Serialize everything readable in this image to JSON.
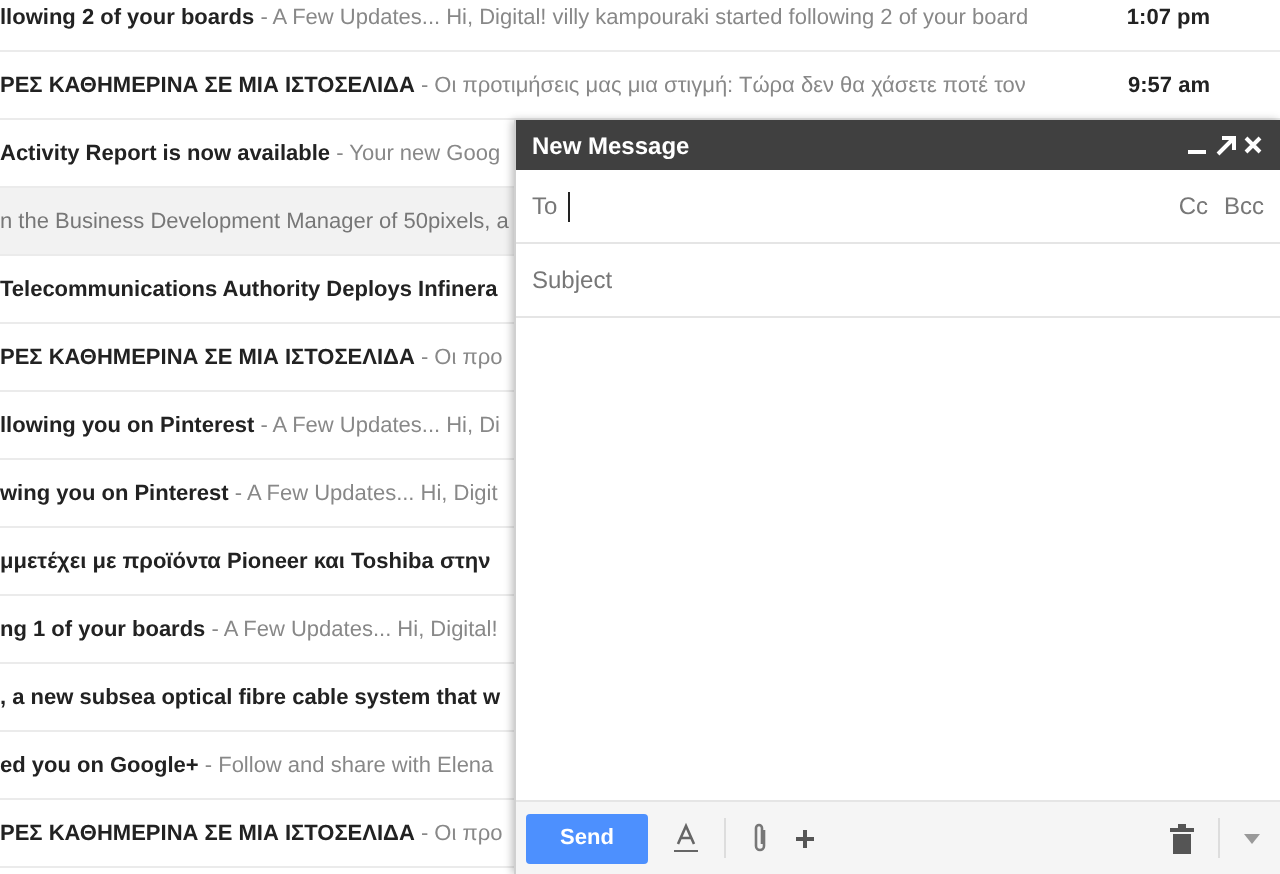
{
  "messages": [
    {
      "subject": "llowing 2 of your boards",
      "snippet": " - A Few Updates... Hi, Digital! villy kampouraki started following 2 of your board",
      "time": "1:07 pm",
      "read": false
    },
    {
      "subject": "ΡΕΣ ΚΑΘΗΜΕΡΙΝΑ ΣΕ ΜΙΑ ΙΣΤΟΣΕΛΙΔΑ",
      "snippet": " - Οι προτιμήσεις μας μια στιγμή: Τώρα δεν θα χάσετε ποτέ τον",
      "time": "9:57 am",
      "read": false
    },
    {
      "subject": "Activity Report is now available",
      "snippet": " - Your new Goog",
      "read": false
    },
    {
      "snippet": "n the Business Development Manager of 50pixels, a",
      "read": true
    },
    {
      "subject": "Telecommunications Authority Deploys Infinera",
      "read": false
    },
    {
      "subject": "ΡΕΣ ΚΑΘΗΜΕΡΙΝΑ ΣΕ ΜΙΑ ΙΣΤΟΣΕΛΙΔΑ",
      "snippet": " - Οι προ",
      "read": false
    },
    {
      "subject": "llowing you on Pinterest",
      "snippet": " - A Few Updates... Hi, Di",
      "read": false
    },
    {
      "subject": "wing you on Pinterest",
      "snippet": " - A Few Updates... Hi, Digit",
      "read": false
    },
    {
      "subject": "μμετέχει με προϊόντα Pioneer και Toshiba στην",
      "read": false
    },
    {
      "subject": "ng 1 of your boards",
      "snippet": " - A Few Updates... Hi, Digital!",
      "read": false
    },
    {
      "subject": ", a new subsea optical fibre cable system that w",
      "read": false
    },
    {
      "subject": "ed you on Google+",
      "snippet": " - Follow and share with Elena",
      "read": false
    },
    {
      "subject": "ΡΕΣ ΚΑΘΗΜΕΡΙΝΑ ΣΕ ΜΙΑ ΙΣΤΟΣΕΛΙΔΑ",
      "snippet": " - Οι προ",
      "read": false
    }
  ],
  "compose": {
    "title": "New Message",
    "to_label": "To",
    "cc": "Cc",
    "bcc": "Bcc",
    "subject_placeholder": "Subject",
    "send": "Send"
  }
}
